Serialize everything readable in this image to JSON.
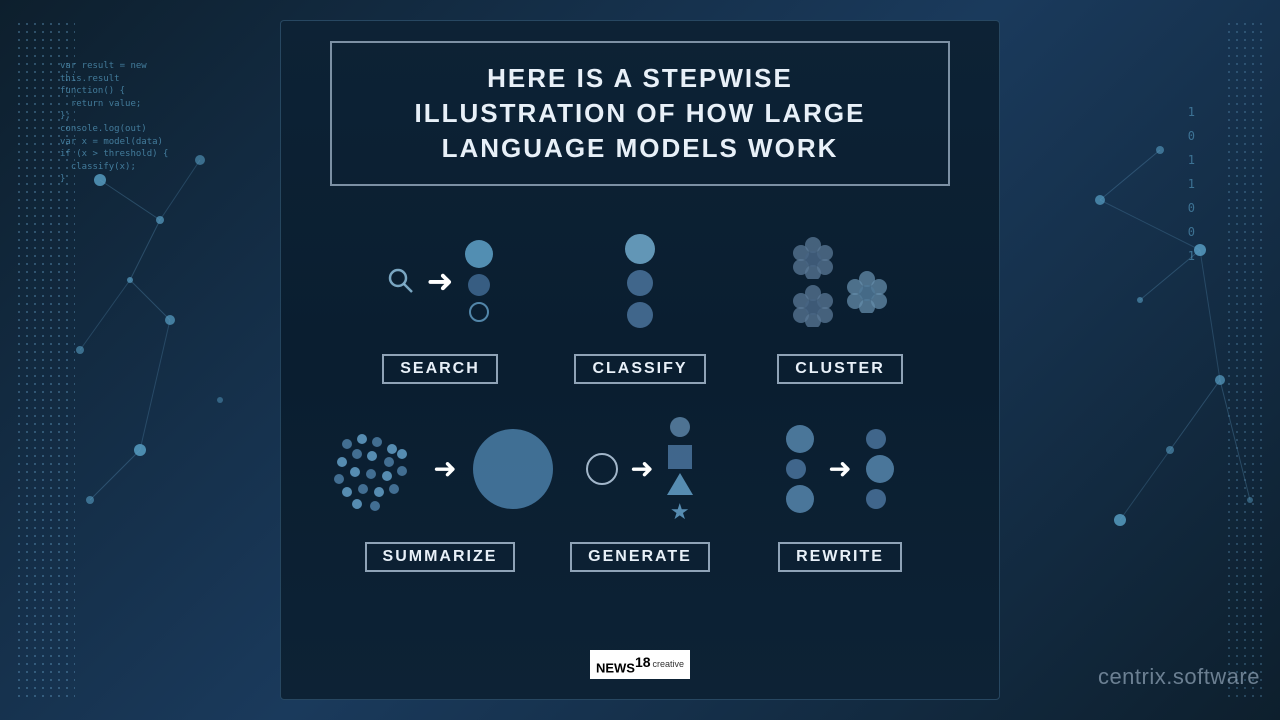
{
  "background": {
    "code_text": "var result = new\nthis.result\nfunction() {\n  return value;\n};\nconsole.log(out)\nvar x = model(data)\nif (x > threshold) {\n  classify(x);\n}"
  },
  "title": {
    "line1": "HERE IS A STEPWISE",
    "line2": "ILLUSTRATION OF HOW LARGE",
    "line3": "LANGUAGE MODELS WORK"
  },
  "steps": {
    "row1": [
      {
        "id": "search",
        "label": "SEARCH"
      },
      {
        "id": "classify",
        "label": "CLASSIFY"
      },
      {
        "id": "cluster",
        "label": "CLUSTER"
      }
    ],
    "row2": [
      {
        "id": "summarize",
        "label": "SUMMARIZE"
      },
      {
        "id": "generate",
        "label": "GENERATE"
      },
      {
        "id": "rewrite",
        "label": "REWRITE"
      }
    ]
  },
  "footer": {
    "brand": "NEWS",
    "brand_num": "18",
    "brand_sub": "creative"
  },
  "watermark": "centrix.software"
}
